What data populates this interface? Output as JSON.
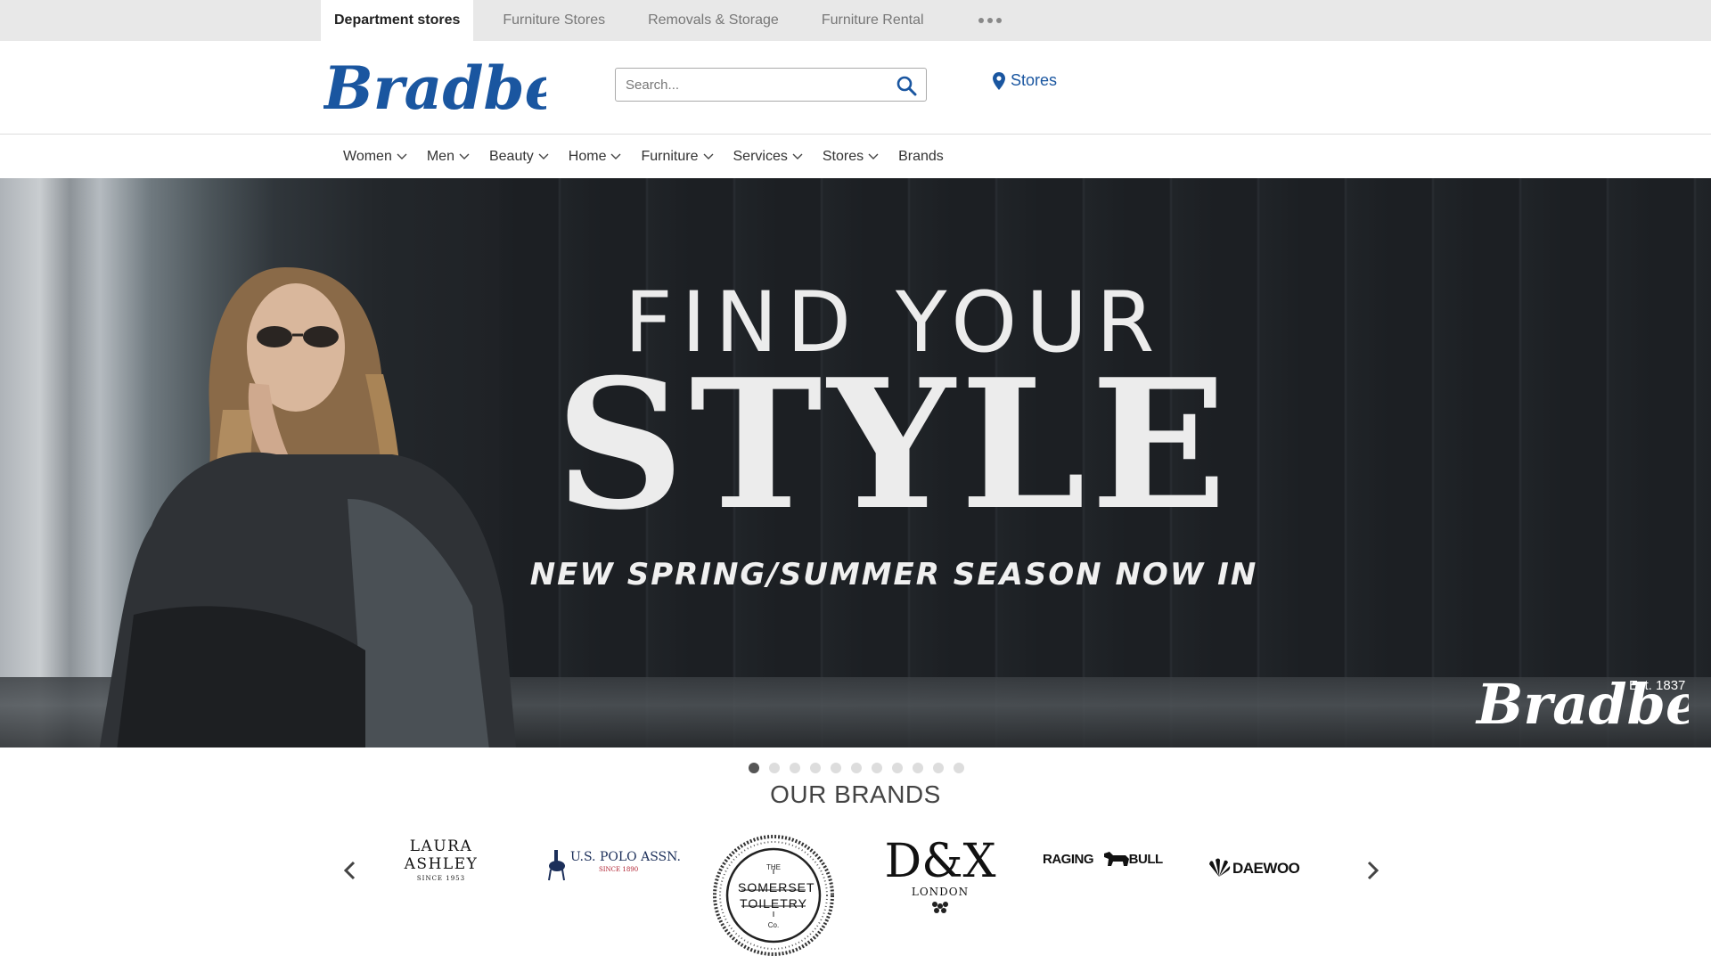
{
  "topbar": {
    "tabs": [
      {
        "label": "Department stores",
        "active": true
      },
      {
        "label": "Furniture Stores",
        "active": false
      },
      {
        "label": "Removals & Storage",
        "active": false
      },
      {
        "label": "Furniture Rental",
        "active": false
      }
    ],
    "more_icon": "ellipsis-icon"
  },
  "header": {
    "logo_text": "Bradbeers",
    "search": {
      "placeholder": "Search...",
      "value": ""
    },
    "stores_label": "Stores"
  },
  "nav": {
    "items": [
      {
        "label": "Women",
        "has_dropdown": true
      },
      {
        "label": "Men",
        "has_dropdown": true
      },
      {
        "label": "Beauty",
        "has_dropdown": true
      },
      {
        "label": "Home",
        "has_dropdown": true
      },
      {
        "label": "Furniture",
        "has_dropdown": true
      },
      {
        "label": "Services",
        "has_dropdown": true
      },
      {
        "label": "Stores",
        "has_dropdown": true
      },
      {
        "label": "Brands",
        "has_dropdown": false
      }
    ]
  },
  "hero": {
    "line1": "FIND YOUR",
    "line2": "STYLE",
    "line3": "NEW SPRING/SUMMER SEASON NOW IN",
    "est": "Est. 1837",
    "logo_text": "Bradbeers"
  },
  "carousel": {
    "slide_count": 11,
    "active_index": 0
  },
  "brands": {
    "title": "OUR BRANDS",
    "items": [
      {
        "name": "LAURA ASHLEY",
        "sub": "SINCE 1953"
      },
      {
        "name": "U.S. POLO ASSN.",
        "sub": "SINCE 1890"
      },
      {
        "name": "SOMERSET TOILETRY",
        "pre": "THE",
        "post": "Co."
      },
      {
        "name": "D&X",
        "sub": "LONDON"
      },
      {
        "name": "RAGING BULL"
      },
      {
        "name": "DAEWOO"
      }
    ]
  },
  "colors": {
    "brand_blue": "#1a56a0",
    "topbar_bg": "#e8e8e8",
    "hero_text": "#ececec"
  }
}
